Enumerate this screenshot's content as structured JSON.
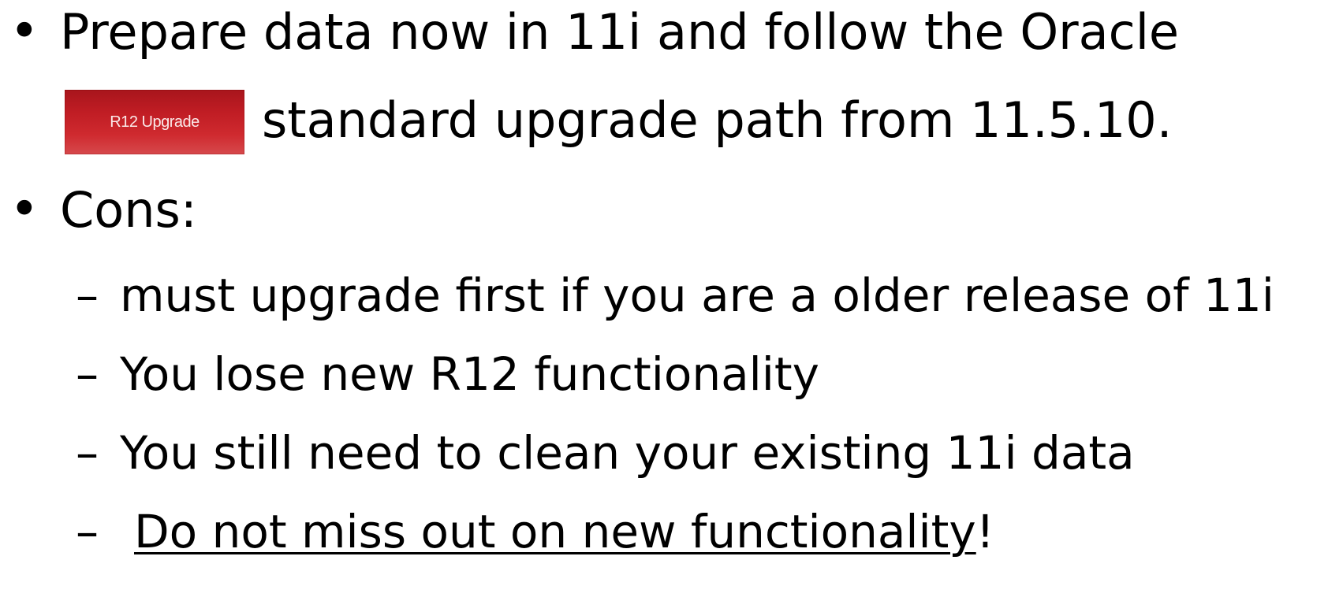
{
  "slide": {
    "bullet_symbol": "•",
    "dash_symbol": "–",
    "item1": {
      "line1": "Prepare data now in 11i and follow the Oracle",
      "badge_label": "R12 Upgrade",
      "line2": "standard upgrade path from 11.5.10."
    },
    "item2": {
      "label": "Cons:"
    },
    "sub_items": {
      "s1": "must upgrade first if you are a older release of 11i",
      "s2": "You lose new R12 functionality",
      "s3": "You still need to clean your existing 11i data",
      "s4_link": "Do not miss out on new functionality",
      "s4_suffix": "!"
    },
    "colors": {
      "badge_red": "#c01d24",
      "text": "#000000"
    }
  }
}
